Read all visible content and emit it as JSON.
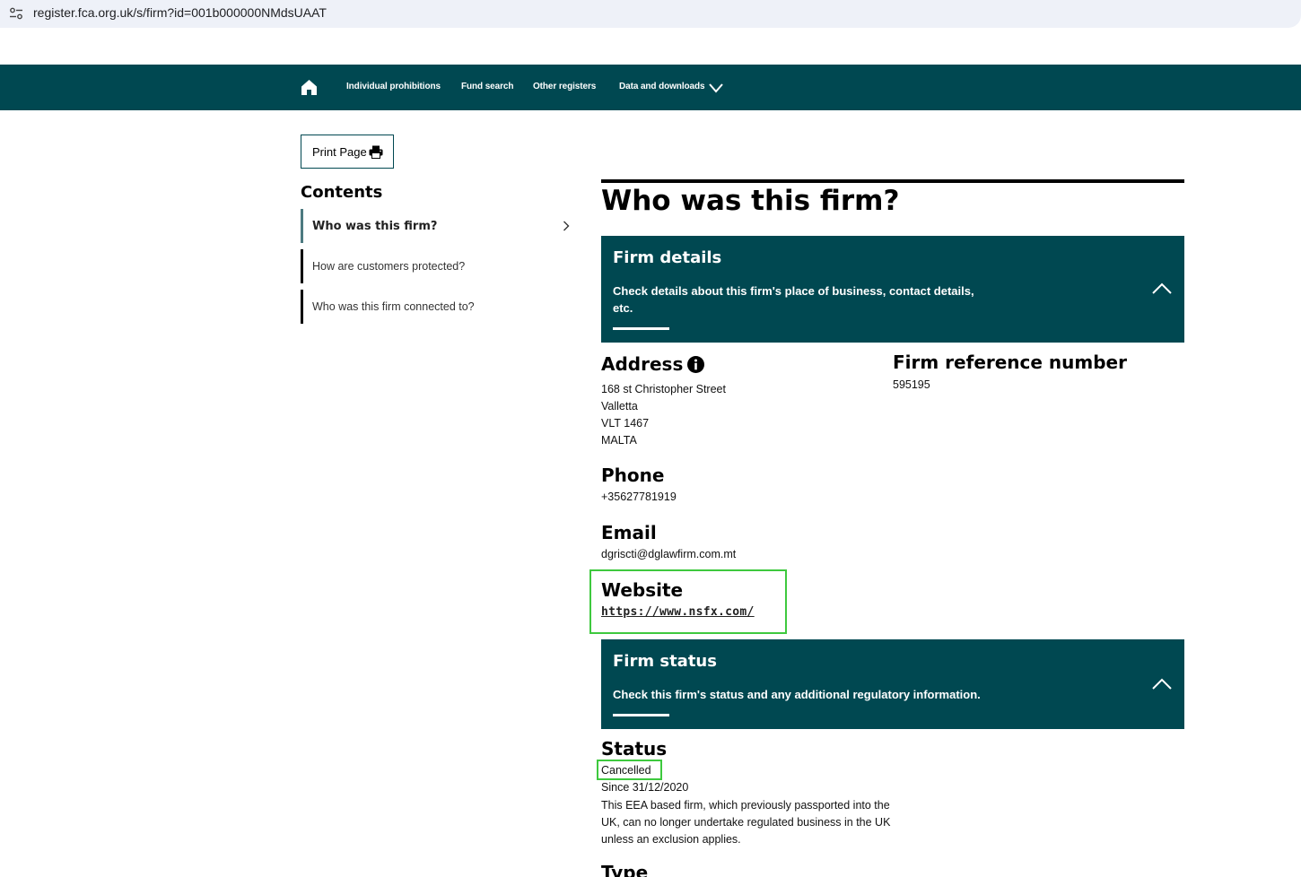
{
  "browser": {
    "url": "register.fca.org.uk/s/firm?id=001b000000NMdsUAAT",
    "site_icon": "tune-icon"
  },
  "nav": {
    "home_icon": "home-icon",
    "items": [
      {
        "label": "Individual prohibitions"
      },
      {
        "label": "Fund search"
      },
      {
        "label": "Other registers"
      },
      {
        "label": "Data and downloads"
      }
    ],
    "dropdown_icon": "chevron-down-icon",
    "background": "#004851"
  },
  "print_button": {
    "label": "Print Page",
    "icon": "printer-icon"
  },
  "contents": {
    "title": "Contents",
    "items": [
      {
        "label": "Who was this firm?",
        "active": true
      },
      {
        "label": "How are customers protected?"
      },
      {
        "label": "Who was this firm connected to?"
      }
    ]
  },
  "main": {
    "title": "Who was this firm?",
    "firm_details_panel": {
      "title": "Firm details",
      "description_line1": "Check details about this firm's place of business, contact details,",
      "description_line2": "etc.",
      "toggle_icon": "chevron-up-icon"
    },
    "address": {
      "label": "Address",
      "info_icon": "info-icon",
      "lines": [
        "168 st Christopher Street",
        "Valletta",
        "VLT 1467",
        "MALTA"
      ]
    },
    "frn": {
      "label": "Firm reference number",
      "value": "595195"
    },
    "phone": {
      "label": "Phone",
      "value": "+35627781919"
    },
    "email": {
      "label": "Email",
      "value": "dgriscti@dglawfirm.com.mt"
    },
    "website": {
      "label": "Website",
      "value": "https://www.nsfx.com/"
    },
    "firm_status_panel": {
      "title": "Firm status",
      "description": "Check this firm's status and any additional regulatory information.",
      "toggle_icon": "chevron-up-icon"
    },
    "status": {
      "label": "Status",
      "value": "Cancelled",
      "since": "Since 31/12/2020",
      "note_lines": [
        "This EEA based firm, which previously passported into the",
        "UK, can no longer undertake regulated business in the UK",
        "unless an exclusion applies."
      ]
    },
    "type": {
      "label": "Type"
    }
  },
  "highlight_color": "#3ec93e"
}
